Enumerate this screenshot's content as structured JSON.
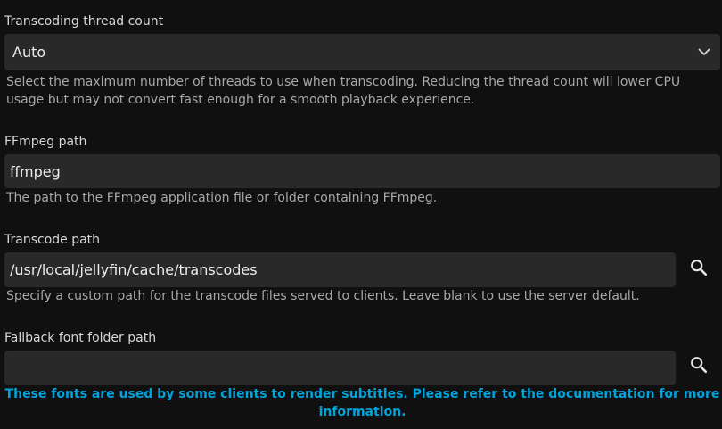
{
  "thread_count": {
    "label": "Transcoding thread count",
    "selected": "Auto",
    "help": "Select the maximum number of threads to use when transcoding. Reducing the thread count will lower CPU usage but may not convert fast enough for a smooth playback experience."
  },
  "ffmpeg_path": {
    "label": "FFmpeg path",
    "value": "ffmpeg",
    "help": "The path to the FFmpeg application file or folder containing FFmpeg."
  },
  "transcode_path": {
    "label": "Transcode path",
    "value": "/usr/local/jellyfin/cache/transcodes",
    "help": "Specify a custom path for the transcode files served to clients. Leave blank to use the server default."
  },
  "fallback_font_path": {
    "label": "Fallback font folder path",
    "value": "",
    "help": "These fonts are used by some clients to render subtitles. Please refer to the documentation for more information."
  },
  "icons": {
    "select_chevron": "chevron-down-icon",
    "browse": "search-icon"
  },
  "colors": {
    "background": "#101010",
    "field": "#292929",
    "accent": "#00a4dc"
  }
}
